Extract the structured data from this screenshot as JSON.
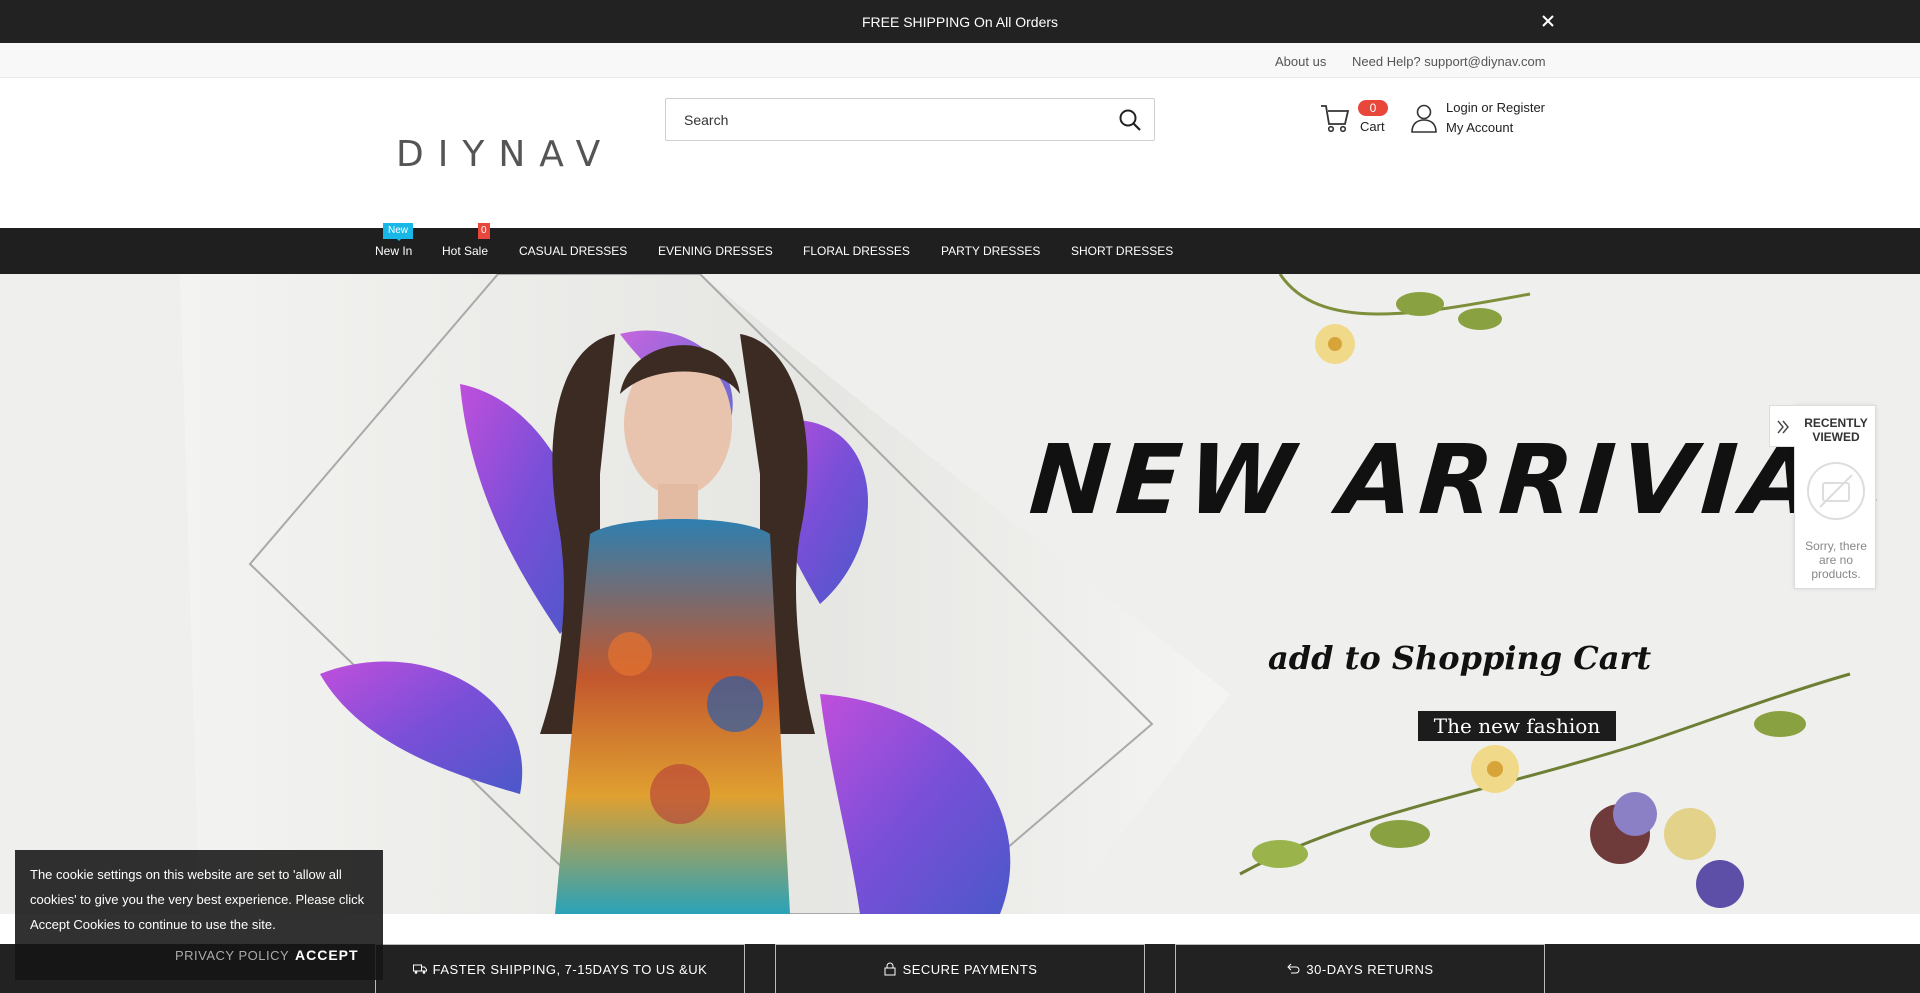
{
  "announcement": {
    "text": "FREE SHIPPING On All Orders",
    "close_icon": "close-icon"
  },
  "utility": {
    "about": "About us",
    "help": "Need Help? support@diynav.com"
  },
  "logo": {
    "text": "DIYNAV"
  },
  "search": {
    "placeholder": "Search",
    "icon": "search-icon"
  },
  "cart": {
    "count": "0",
    "label": "Cart",
    "icon": "cart-icon"
  },
  "account": {
    "line1": "Login or Register",
    "line2": "My Account",
    "icon": "user-icon"
  },
  "nav": {
    "items": [
      {
        "label": "New In",
        "tag": "New"
      },
      {
        "label": "Hot Sale",
        "tag": "0"
      },
      {
        "label": "CASUAL DRESSES"
      },
      {
        "label": "EVENING DRESSES"
      },
      {
        "label": "FLORAL DRESSES"
      },
      {
        "label": "PARTY DRESSES"
      },
      {
        "label": "SHORT DRESSES"
      }
    ]
  },
  "hero": {
    "headline": "NEW ARRIVIAL",
    "subline": "add to Shopping Cart",
    "badge": "The new fashion"
  },
  "recently_viewed": {
    "title_line1": "RECENTLY",
    "title_line2": "VIEWED",
    "empty_message": "Sorry, there are no products."
  },
  "cookie": {
    "text": "The cookie settings on this website are set to 'allow all cookies' to give you the very best experience. Please click Accept Cookies to continue to use the site.",
    "privacy": "PRIVACY POLICY",
    "accept": "ACCEPT"
  },
  "features": [
    {
      "label": "FASTER SHIPPING, 7-15DAYS TO US &UK",
      "icon": "truck-icon"
    },
    {
      "label": "SECURE PAYMENTS",
      "icon": "lock-icon"
    },
    {
      "label": "30-DAYS RETURNS",
      "icon": "return-icon"
    }
  ],
  "colors": {
    "dark": "#222222",
    "accent_red": "#e8473c",
    "accent_blue": "#19b6e8"
  }
}
